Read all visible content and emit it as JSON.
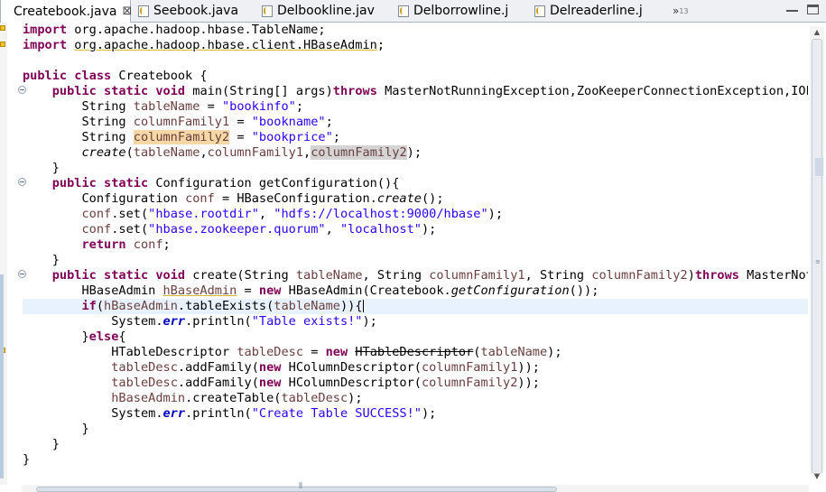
{
  "tabs": [
    {
      "label": "Createbook.java",
      "active": true,
      "close": "⊠"
    },
    {
      "label": "Seebook.java",
      "active": false
    },
    {
      "label": "Delbookline.jav",
      "active": false
    },
    {
      "label": "Delborrowline.j",
      "active": false
    },
    {
      "label": "Delreaderline.j",
      "active": false
    }
  ],
  "overflow": {
    "chevron": "»",
    "count": "13"
  },
  "window_controls": [
    "minimize",
    "maximize"
  ],
  "editor": {
    "current_line_index": 18,
    "code_lines": [
      [
        {
          "t": "import",
          "c": "kw"
        },
        {
          "t": " org.apache.hadoop.hbase.TableName;"
        }
      ],
      [
        {
          "t": "import",
          "c": "kw"
        },
        {
          "t": " "
        },
        {
          "t": "org.apache.hadoop.hbase.client.HBaseAdmin",
          "c": "warnul"
        },
        {
          "t": ";"
        }
      ],
      [
        {
          "t": ""
        }
      ],
      [
        {
          "t": "public",
          "c": "kw"
        },
        {
          "t": " "
        },
        {
          "t": "class",
          "c": "kw"
        },
        {
          "t": " Createbook {"
        }
      ],
      [
        {
          "t": "    "
        },
        {
          "t": "public",
          "c": "kw"
        },
        {
          "t": " "
        },
        {
          "t": "static",
          "c": "kw"
        },
        {
          "t": " "
        },
        {
          "t": "void",
          "c": "kw"
        },
        {
          "t": " main(String[] args)"
        },
        {
          "t": "throws",
          "c": "kw"
        },
        {
          "t": " MasterNotRunningException,ZooKeeperConnectionException,IOExce"
        }
      ],
      [
        {
          "t": "        String "
        },
        {
          "t": "tableName",
          "c": "var"
        },
        {
          "t": " = "
        },
        {
          "t": "\"bookinfo\"",
          "c": "str"
        },
        {
          "t": ";"
        }
      ],
      [
        {
          "t": "        String "
        },
        {
          "t": "columnFamily1",
          "c": "var"
        },
        {
          "t": " = "
        },
        {
          "t": "\"bookname\"",
          "c": "str"
        },
        {
          "t": ";"
        }
      ],
      [
        {
          "t": "        String "
        },
        {
          "t": "columnFamily2",
          "c": "var occw"
        },
        {
          "t": " = "
        },
        {
          "t": "\"bookprice\"",
          "c": "str"
        },
        {
          "t": ";"
        }
      ],
      [
        {
          "t": "        "
        },
        {
          "t": "create",
          "c": "stat"
        },
        {
          "t": "("
        },
        {
          "t": "tableName",
          "c": "var"
        },
        {
          "t": ","
        },
        {
          "t": "columnFamily1",
          "c": "var"
        },
        {
          "t": ","
        },
        {
          "t": "columnFamily2",
          "c": "var occ"
        },
        {
          "t": ");"
        }
      ],
      [
        {
          "t": "    }"
        }
      ],
      [
        {
          "t": "    "
        },
        {
          "t": "public",
          "c": "kw"
        },
        {
          "t": " "
        },
        {
          "t": "static",
          "c": "kw"
        },
        {
          "t": " Configuration getConfiguration(){"
        }
      ],
      [
        {
          "t": "        Configuration "
        },
        {
          "t": "conf",
          "c": "var"
        },
        {
          "t": " = HBaseConfiguration."
        },
        {
          "t": "create",
          "c": "stat"
        },
        {
          "t": "();"
        }
      ],
      [
        {
          "t": "        "
        },
        {
          "t": "conf",
          "c": "var"
        },
        {
          "t": ".set("
        },
        {
          "t": "\"hbase.rootdir\"",
          "c": "str"
        },
        {
          "t": ", "
        },
        {
          "t": "\"hdfs://localhost:9000/hbase\"",
          "c": "str"
        },
        {
          "t": ");"
        }
      ],
      [
        {
          "t": "        "
        },
        {
          "t": "conf",
          "c": "var"
        },
        {
          "t": ".set("
        },
        {
          "t": "\"hbase.zookeeper.quorum\"",
          "c": "str"
        },
        {
          "t": ", "
        },
        {
          "t": "\"localhost\"",
          "c": "str"
        },
        {
          "t": ");"
        }
      ],
      [
        {
          "t": "        "
        },
        {
          "t": "return",
          "c": "kw"
        },
        {
          "t": " "
        },
        {
          "t": "conf",
          "c": "var"
        },
        {
          "t": ";"
        }
      ],
      [
        {
          "t": "    }"
        }
      ],
      [
        {
          "t": "    "
        },
        {
          "t": "public",
          "c": "kw"
        },
        {
          "t": " "
        },
        {
          "t": "static",
          "c": "kw"
        },
        {
          "t": " "
        },
        {
          "t": "void",
          "c": "kw"
        },
        {
          "t": " create(String "
        },
        {
          "t": "tableName",
          "c": "var"
        },
        {
          "t": ", String "
        },
        {
          "t": "columnFamily1",
          "c": "var"
        },
        {
          "t": ", String "
        },
        {
          "t": "columnFamily2",
          "c": "var"
        },
        {
          "t": ")"
        },
        {
          "t": "throws",
          "c": "kw"
        },
        {
          "t": " MasterNotRun"
        }
      ],
      [
        {
          "t": "        HBaseAdmin "
        },
        {
          "t": "hBaseAdmin",
          "c": "var warnul"
        },
        {
          "t": " = "
        },
        {
          "t": "new",
          "c": "kw"
        },
        {
          "t": " HBaseAdmin(Createbook."
        },
        {
          "t": "getConfiguration",
          "c": "stat"
        },
        {
          "t": "());"
        }
      ],
      [
        {
          "t": "        "
        },
        {
          "t": "if",
          "c": "kw"
        },
        {
          "t": "("
        },
        {
          "t": "hBaseAdmin",
          "c": "var"
        },
        {
          "t": ".tableExists("
        },
        {
          "t": "tableName",
          "c": "var"
        },
        {
          "t": ")){"
        },
        {
          "t": "",
          "c": "caret"
        }
      ],
      [
        {
          "t": "            System."
        },
        {
          "t": "err",
          "c": "fld"
        },
        {
          "t": ".println("
        },
        {
          "t": "\"Table exists!\"",
          "c": "str"
        },
        {
          "t": ");"
        }
      ],
      [
        {
          "t": "        }"
        },
        {
          "t": "else",
          "c": "kw"
        },
        {
          "t": "{"
        }
      ],
      [
        {
          "t": "            HTableDescriptor "
        },
        {
          "t": "tableDesc",
          "c": "var"
        },
        {
          "t": " = "
        },
        {
          "t": "new",
          "c": "kw"
        },
        {
          "t": " "
        },
        {
          "t": "HTableDescriptor",
          "c": "strike"
        },
        {
          "t": "("
        },
        {
          "t": "tableName",
          "c": "var"
        },
        {
          "t": ");"
        }
      ],
      [
        {
          "t": "            "
        },
        {
          "t": "tableDesc",
          "c": "var"
        },
        {
          "t": ".addFamily("
        },
        {
          "t": "new",
          "c": "kw"
        },
        {
          "t": " HColumnDescriptor("
        },
        {
          "t": "columnFamily1",
          "c": "var"
        },
        {
          "t": "));"
        }
      ],
      [
        {
          "t": "            "
        },
        {
          "t": "tableDesc",
          "c": "var"
        },
        {
          "t": ".addFamily("
        },
        {
          "t": "new",
          "c": "kw"
        },
        {
          "t": " HColumnDescriptor("
        },
        {
          "t": "columnFamily2",
          "c": "var"
        },
        {
          "t": "));"
        }
      ],
      [
        {
          "t": "            "
        },
        {
          "t": "hBaseAdmin",
          "c": "var"
        },
        {
          "t": ".createTable("
        },
        {
          "t": "tableDesc",
          "c": "var"
        },
        {
          "t": ");"
        }
      ],
      [
        {
          "t": "            System."
        },
        {
          "t": "err",
          "c": "fld"
        },
        {
          "t": ".println("
        },
        {
          "t": "\"Create Table SUCCESS!\"",
          "c": "str"
        },
        {
          "t": ");"
        }
      ],
      [
        {
          "t": "        }"
        }
      ],
      [
        {
          "t": "    }"
        }
      ],
      [
        {
          "t": "}"
        }
      ]
    ]
  }
}
